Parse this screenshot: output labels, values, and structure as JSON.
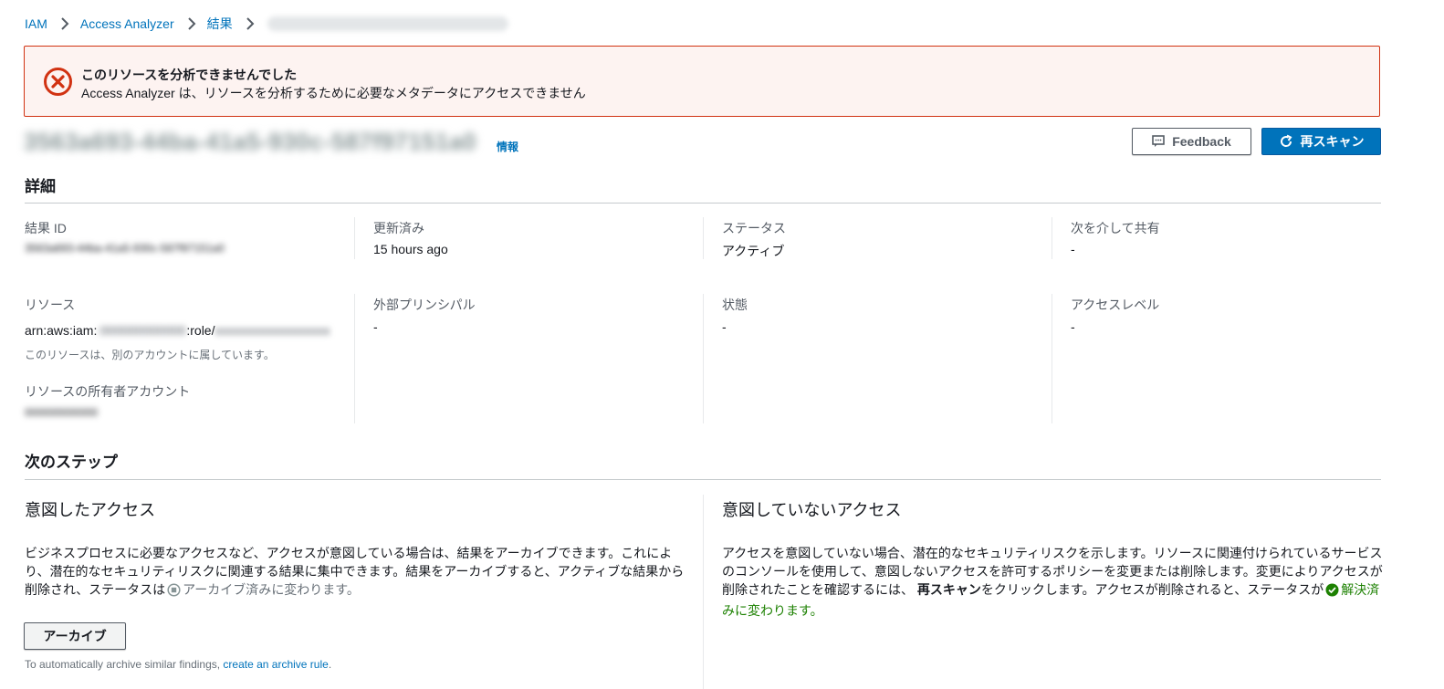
{
  "breadcrumb": {
    "items": [
      "IAM",
      "Access Analyzer",
      "結果"
    ],
    "current_blurred": "00000000-0000-0000-0000-000000000000"
  },
  "alert": {
    "title": "このリソースを分析できませんでした",
    "body": "Access Analyzer は、リソースを分析するために必要なメタデータにアクセスできません",
    "color": "#d13212"
  },
  "header": {
    "finding_id_blurred": "3563a693-44ba-41a5-930c-587f97151a0",
    "info": "情報",
    "feedback_label": "Feedback",
    "rescan_label": "再スキャン"
  },
  "details": {
    "title": "詳細",
    "finding_id_label": "結果 ID",
    "finding_id_value": "3563a693-44ba-41a5-930c-587f97151a0",
    "updated_label": "更新済み",
    "updated_value": "15 hours ago",
    "status_label": "ステータス",
    "status_value": "アクティブ",
    "shared_via_label": "次を介して共有",
    "shared_via_value": "-",
    "resource_label": "リソース",
    "resource_prefix": "arn:aws:iam:",
    "resource_account_blurred": ":000000000000",
    "resource_role": ":role/",
    "resource_name_blurred": "xxxxxxxxxxxxxxxxxx",
    "resource_note": "このリソースは、別のアカウントに属しています。",
    "owner_label": "リソースの所有者アカウント",
    "owner_value_blurred": "000000000000",
    "principal_label": "外部プリンシパル",
    "principal_value": "-",
    "condition_label": "状態",
    "condition_value": "-",
    "access_level_label": "アクセスレベル",
    "access_level_value": "-"
  },
  "next_steps": {
    "title": "次のステップ",
    "intended": {
      "title": "意図したアクセス",
      "text1": "ビジネスプロセスに必要なアクセスなど、アクセスが意図している場合は、結果をアーカイブできます。これによ",
      "text2": "り、潜在的なセキュリティリスクに関連する結果に集中できます。結果をアーカイブすると、アクティブな結果から",
      "text3": "削除され、ステータスは",
      "archived_status": "アーカイブ済み",
      "text4": "に変わります。",
      "archive_button": "アーカイブ",
      "hint_prefix": "To automatically archive similar findings, ",
      "hint_link": "create an archive rule",
      "hint_suffix": "."
    },
    "unintended": {
      "title": "意図していないアクセス",
      "text1": "アクセスを意図していない場合、潜在的なセキュリティリスクを示します。リソースに関連付けられているサービス",
      "text2": "のコンソールを使用して、意図しないアクセスを許可するポリシーを変更または削除します。変更によりアクセスが",
      "text3a": "削除されたことを確認するには、",
      "text3_bold": "再スキャン",
      "text3b": "をクリックします。アクセスが削除されると、ステータスが",
      "resolved_status": "解決済",
      "text4": "みに変わります。"
    }
  },
  "colors": {
    "link": "#0073bb",
    "primary": "#0073bb",
    "error": "#d13212",
    "success": "#1d8102"
  }
}
